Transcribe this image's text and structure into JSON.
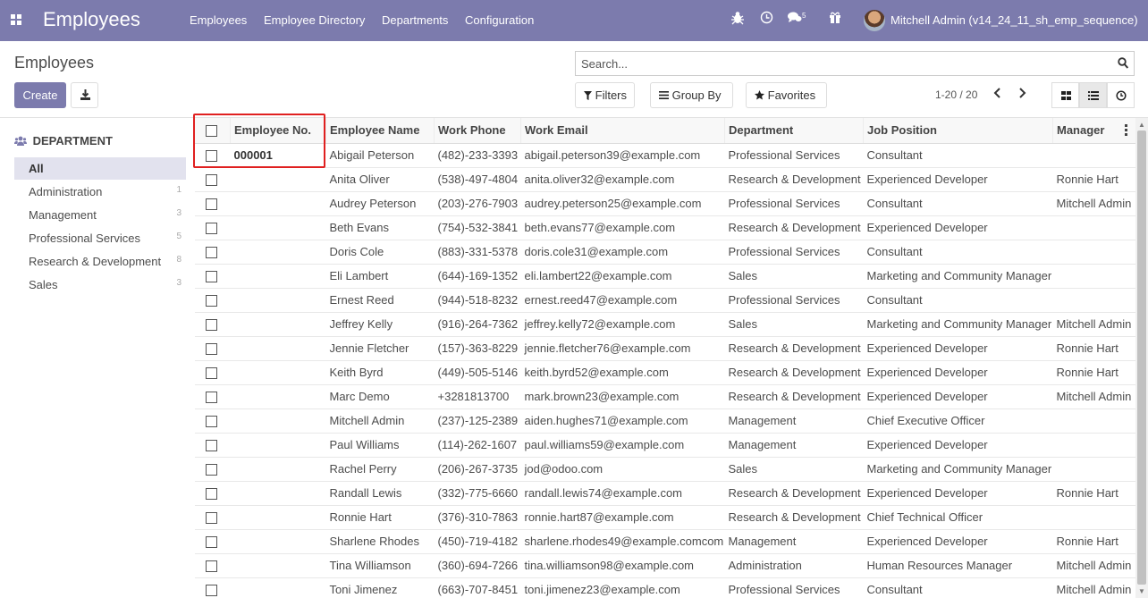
{
  "navbar": {
    "app_name": "Employees",
    "menu": [
      "Employees",
      "Employee Directory",
      "Departments",
      "Configuration"
    ],
    "chat_count": "5",
    "user_name": "Mitchell Admin (v14_24_11_sh_emp_sequence)",
    "bg_color": "#7c7bad"
  },
  "control": {
    "title": "Employees",
    "create_label": "Create",
    "search_placeholder": "Search...",
    "filters_label": "Filters",
    "groupby_label": "Group By",
    "favorites_label": "Favorites",
    "pager_text": "1-20 / 20"
  },
  "sidebar": {
    "header": "DEPARTMENT",
    "items": [
      {
        "label": "All",
        "count": ""
      },
      {
        "label": "Administration",
        "count": "1"
      },
      {
        "label": "Management",
        "count": "3"
      },
      {
        "label": "Professional Services",
        "count": "5"
      },
      {
        "label": "Research & Development",
        "count": "8"
      },
      {
        "label": "Sales",
        "count": "3"
      }
    ]
  },
  "table": {
    "columns": [
      "Employee No.",
      "Employee Name",
      "Work Phone",
      "Work Email",
      "Department",
      "Job Position",
      "Manager"
    ],
    "rows": [
      [
        "000001",
        "Abigail Peterson",
        "(482)-233-3393",
        "abigail.peterson39@example.com",
        "Professional Services",
        "Consultant",
        ""
      ],
      [
        "",
        "Anita Oliver",
        "(538)-497-4804",
        "anita.oliver32@example.com",
        "Research & Development",
        "Experienced Developer",
        "Ronnie Hart"
      ],
      [
        "",
        "Audrey Peterson",
        "(203)-276-7903",
        "audrey.peterson25@example.com",
        "Professional Services",
        "Consultant",
        "Mitchell Admin"
      ],
      [
        "",
        "Beth Evans",
        "(754)-532-3841",
        "beth.evans77@example.com",
        "Research & Development",
        "Experienced Developer",
        ""
      ],
      [
        "",
        "Doris Cole",
        "(883)-331-5378",
        "doris.cole31@example.com",
        "Professional Services",
        "Consultant",
        ""
      ],
      [
        "",
        "Eli Lambert",
        "(644)-169-1352",
        "eli.lambert22@example.com",
        "Sales",
        "Marketing and Community Manager",
        ""
      ],
      [
        "",
        "Ernest Reed",
        "(944)-518-8232",
        "ernest.reed47@example.com",
        "Professional Services",
        "Consultant",
        ""
      ],
      [
        "",
        "Jeffrey Kelly",
        "(916)-264-7362",
        "jeffrey.kelly72@example.com",
        "Sales",
        "Marketing and Community Manager",
        "Mitchell Admin"
      ],
      [
        "",
        "Jennie Fletcher",
        "(157)-363-8229",
        "jennie.fletcher76@example.com",
        "Research & Development",
        "Experienced Developer",
        "Ronnie Hart"
      ],
      [
        "",
        "Keith Byrd",
        "(449)-505-5146",
        "keith.byrd52@example.com",
        "Research & Development",
        "Experienced Developer",
        "Ronnie Hart"
      ],
      [
        "",
        "Marc Demo",
        "+3281813700",
        "mark.brown23@example.com",
        "Research & Development",
        "Experienced Developer",
        "Mitchell Admin"
      ],
      [
        "",
        "Mitchell Admin",
        "(237)-125-2389",
        "aiden.hughes71@example.com",
        "Management",
        "Chief Executive Officer",
        ""
      ],
      [
        "",
        "Paul Williams",
        "(114)-262-1607",
        "paul.williams59@example.com",
        "Management",
        "Experienced Developer",
        ""
      ],
      [
        "",
        "Rachel Perry",
        "(206)-267-3735",
        "jod@odoo.com",
        "Sales",
        "Marketing and Community Manager",
        ""
      ],
      [
        "",
        "Randall Lewis",
        "(332)-775-6660",
        "randall.lewis74@example.com",
        "Research & Development",
        "Experienced Developer",
        "Ronnie Hart"
      ],
      [
        "",
        "Ronnie Hart",
        "(376)-310-7863",
        "ronnie.hart87@example.com",
        "Research & Development",
        "Chief Technical Officer",
        ""
      ],
      [
        "",
        "Sharlene Rhodes",
        "(450)-719-4182",
        "sharlene.rhodes49@example.comcom",
        "Management",
        "Experienced Developer",
        "Ronnie Hart"
      ],
      [
        "",
        "Tina Williamson",
        "(360)-694-7266",
        "tina.williamson98@example.com",
        "Administration",
        "Human Resources Manager",
        "Mitchell Admin"
      ],
      [
        "",
        "Toni Jimenez",
        "(663)-707-8451",
        "toni.jimenez23@example.com",
        "Professional Services",
        "Consultant",
        "Mitchell Admin"
      ]
    ]
  }
}
